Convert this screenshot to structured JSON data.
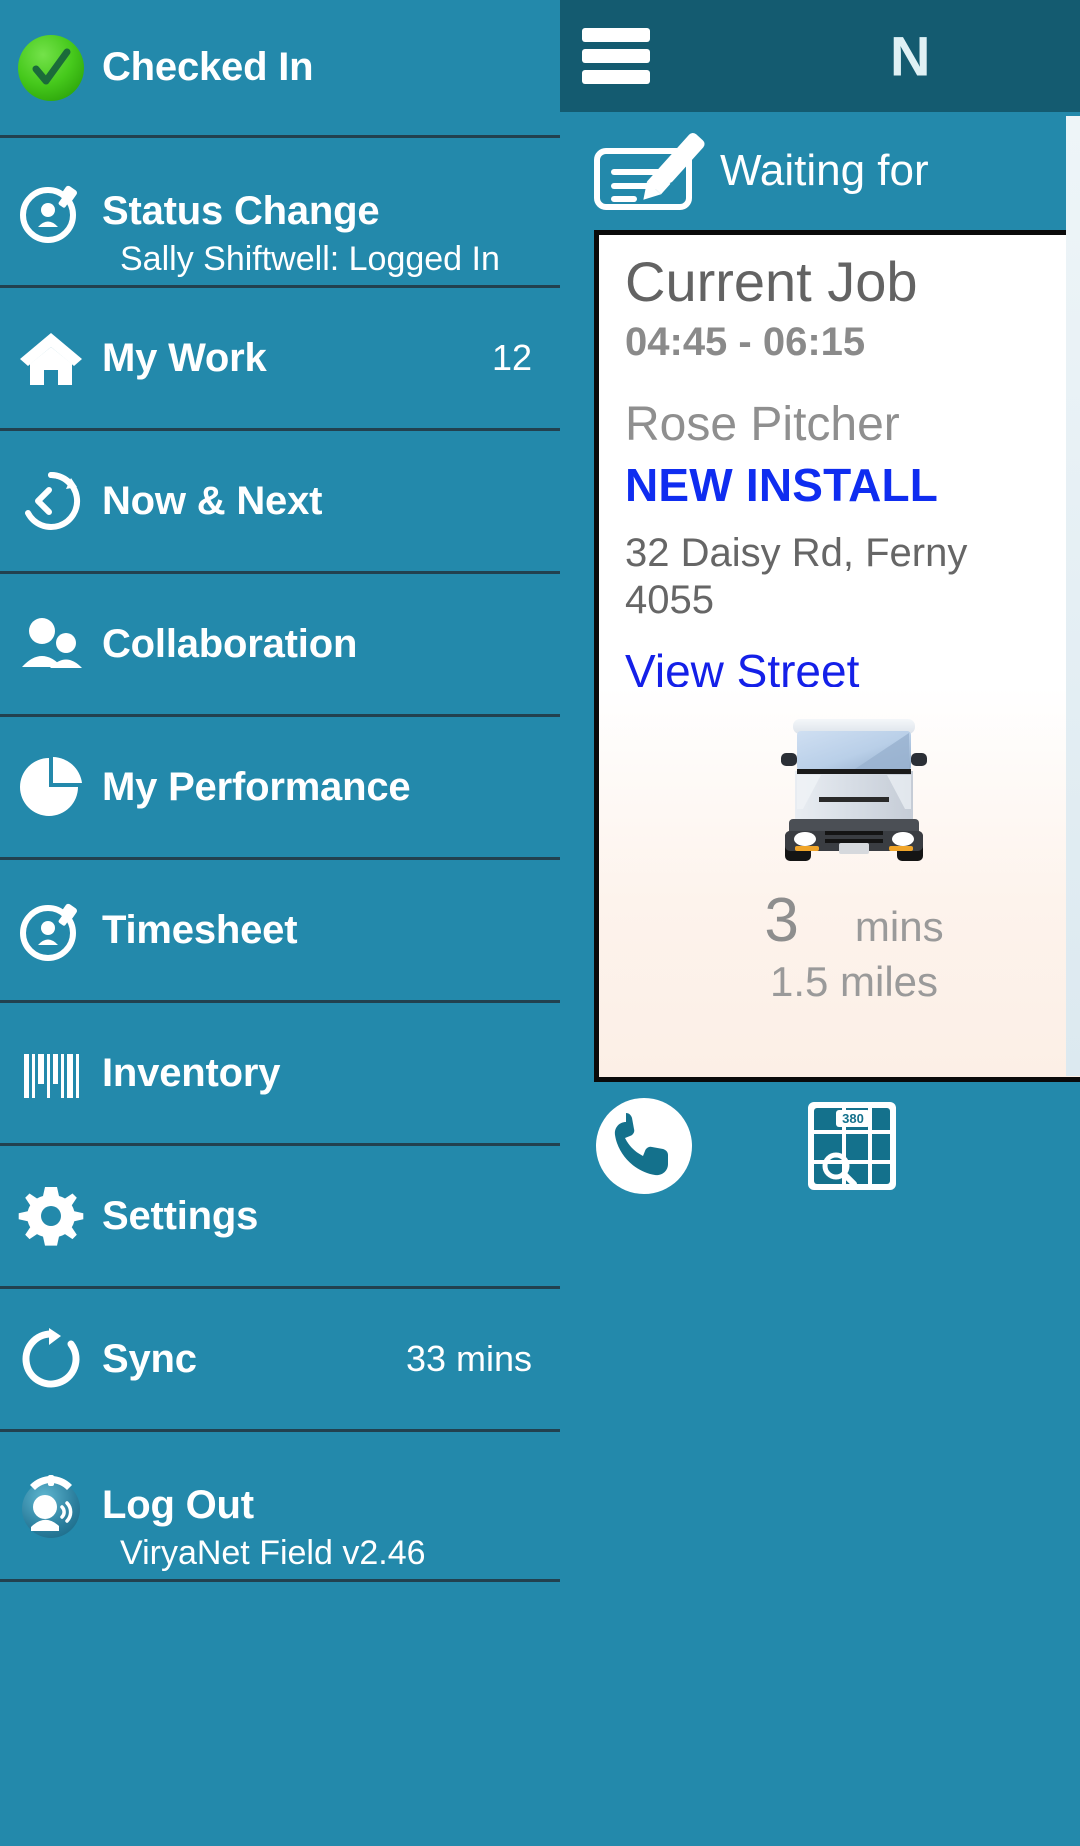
{
  "app": {
    "name": "ViryaNet Field",
    "version_label": "ViryaNet Field v2.46"
  },
  "colors": {
    "sidebar_bg": "#2389ab",
    "topbar_bg": "#145b70",
    "divider": "#22414f",
    "accent_blue": "#0f2df0",
    "link_blue": "#1420e8",
    "checked_in_green": "#3fc316",
    "card_bg": "#ffffff",
    "card_border": "#0a0a0a",
    "muted_text": "#8a8a8a"
  },
  "sidebar": {
    "header": {
      "label": "Checked In",
      "icon": "green-check-circle-icon"
    },
    "items": [
      {
        "label": "Status Change",
        "sublabel": "Sally Shiftwell: Logged In",
        "icon": "stopwatch-person-icon",
        "right": ""
      },
      {
        "label": "My Work",
        "sublabel": "",
        "icon": "home-icon",
        "right": "12"
      },
      {
        "label": "Now & Next",
        "sublabel": "",
        "icon": "clock-rewind-icon",
        "right": ""
      },
      {
        "label": "Collaboration",
        "sublabel": "",
        "icon": "people-icon",
        "right": ""
      },
      {
        "label": "My Performance",
        "sublabel": "",
        "icon": "pie-chart-icon",
        "right": ""
      },
      {
        "label": "Timesheet",
        "sublabel": "",
        "icon": "stopwatch-person-icon",
        "right": ""
      },
      {
        "label": "Inventory",
        "sublabel": "",
        "icon": "barcode-icon",
        "right": ""
      },
      {
        "label": "Settings",
        "sublabel": "",
        "icon": "gear-icon",
        "right": ""
      },
      {
        "label": "Sync",
        "sublabel": "",
        "icon": "refresh-circle-icon",
        "right": "33 mins"
      },
      {
        "label": "Log Out",
        "sublabel": "ViryaNet Field v2.46",
        "icon": "speaking-head-icon",
        "right": ""
      }
    ]
  },
  "topbar": {
    "menu_icon": "hamburger-menu-icon",
    "title": "N"
  },
  "status_bar": {
    "icon": "sign-document-icon",
    "text": "Waiting for"
  },
  "job_card": {
    "title": "Current Job",
    "time_range": "04:45 - 06:15",
    "customer": "Rose Pitcher",
    "job_type": "NEW INSTALL",
    "address_line1": "32 Daisy Rd, Ferny",
    "address_line2": "4055",
    "street_view_link": "View Street",
    "vehicle_icon": "delivery-van-icon",
    "travel": {
      "duration_value": "3",
      "duration_unit": "mins",
      "distance": "1.5 miles"
    }
  },
  "actions": [
    {
      "name": "call-button",
      "icon": "phone-icon"
    },
    {
      "name": "map-button",
      "icon": "map-search-icon",
      "badge": "380"
    }
  ]
}
